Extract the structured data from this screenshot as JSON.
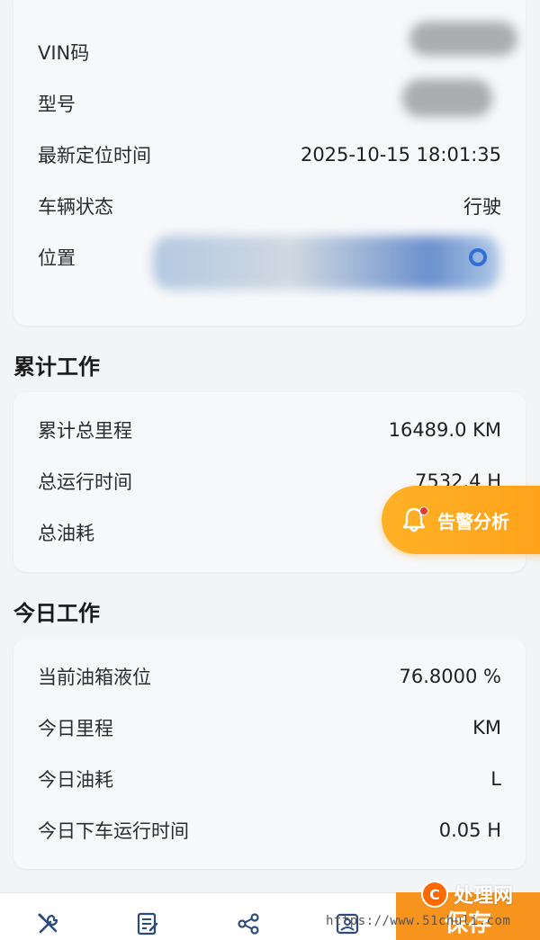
{
  "vehicle_info": {
    "rows": [
      {
        "label": "VIN码",
        "value": ""
      },
      {
        "label": "型号",
        "value": ""
      },
      {
        "label": "最新定位时间",
        "value": "2025-10-15 18:01:35"
      },
      {
        "label": "车辆状态",
        "value": "行驶"
      },
      {
        "label": "位置",
        "value": ""
      }
    ]
  },
  "cumulative": {
    "title": "累计工作",
    "rows": [
      {
        "label": "累计总里程",
        "value": "16489.0 KM"
      },
      {
        "label": "总运行时间",
        "value": "7532.4 H"
      },
      {
        "label": "总油耗",
        "value": ""
      }
    ]
  },
  "today": {
    "title": "今日工作",
    "rows": [
      {
        "label": "当前油箱液位",
        "value": "76.8000 %"
      },
      {
        "label": "今日里程",
        "value": "KM"
      },
      {
        "label": "今日油耗",
        "value": "L"
      },
      {
        "label": "今日下车运行时间",
        "value": "0.05 H"
      }
    ]
  },
  "alert_button": {
    "label": "告警分析",
    "icon": "bell-icon",
    "color": "#ffa21a"
  },
  "bottom_nav": {
    "icons": [
      "tools-icon",
      "document-edit-icon",
      "share-icon",
      "image-icon"
    ],
    "save_label": "保存",
    "save_color": "#f7941d"
  },
  "watermark": {
    "logo_text": "处理网",
    "logo_letter": "C",
    "url": "https://www.51chuli.com"
  },
  "colors": {
    "background": "#f2f4f6",
    "card": "#f7f8fa",
    "location_icon": "#2f6fd6"
  }
}
